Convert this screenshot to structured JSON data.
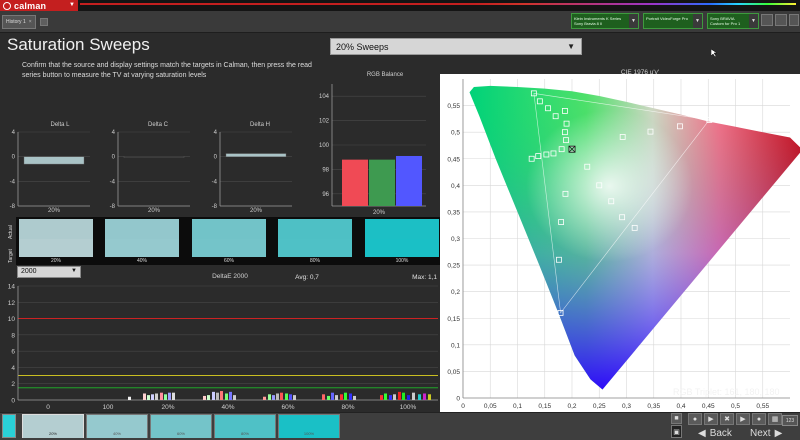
{
  "app": {
    "logo_text": "calman",
    "history_tab": "History 1",
    "devices": [
      {
        "line1": "Klein Instruments K Series",
        "line2": "Sony Bravia 8 II"
      },
      {
        "line1": "Portrait VideoForge Pro",
        "line2": ""
      },
      {
        "line1": "Sony BRAVIA",
        "line2": "Custom for Pro 1"
      }
    ]
  },
  "header": {
    "title": "Saturation Sweeps",
    "instructions": "Confirm that the source and display settings match the targets in Calman, then press the read series button to measure the TV at varying saturation levels",
    "sweep_select": "20% Sweeps"
  },
  "delta_charts": [
    {
      "title": "Delta L",
      "x_label": "20%",
      "value": -1.2,
      "bar_color": "#a9c3c6"
    },
    {
      "title": "Delta C",
      "x_label": "20%",
      "value": 0.05,
      "bar_color": "#1b1b1b"
    },
    {
      "title": "Delta H",
      "x_label": "20%",
      "value": 0.5,
      "bar_color": "#a9c3c6"
    }
  ],
  "delta_ticks": [
    "4",
    "0",
    "-4",
    "-8"
  ],
  "rgb_balance": {
    "title": "RGB Balance",
    "x_label": "20%",
    "ticks": [
      "104",
      "102",
      "100",
      "98",
      "96"
    ],
    "values": {
      "r": 98.8,
      "g": 98.8,
      "b": 99.1
    },
    "colors": {
      "r": "#f04a55",
      "g": "#3e9a50",
      "b": "#5257ff"
    }
  },
  "swatches": {
    "side_labels": [
      "Target",
      "Actual"
    ],
    "items": [
      {
        "label": "20%",
        "target": "#b4ced1",
        "actual": "#aecbce"
      },
      {
        "label": "40%",
        "target": "#95c9ce",
        "actual": "#93c7cc"
      },
      {
        "label": "60%",
        "target": "#74c4c9",
        "actual": "#72c3c8"
      },
      {
        "label": "80%",
        "target": "#4fc1c6",
        "actual": "#4ec0c5"
      },
      {
        "label": "100%",
        "target": "#1ac0c6",
        "actual": "#1cbfc5"
      }
    ]
  },
  "deltae": {
    "select_value": "2000",
    "title": "DeltaE 2000",
    "avg": "Avg: 0,7",
    "max": "Max: 1,1",
    "y_ticks": [
      "14",
      "12",
      "10",
      "8",
      "6",
      "4",
      "2",
      "0"
    ],
    "x_ticks": [
      "0",
      "100",
      "20%",
      "40%",
      "60%",
      "80%",
      "100%"
    ]
  },
  "cie": {
    "title": "CIE 1976 u'v'",
    "y_ticks": [
      "0,55",
      "0,5",
      "0,45",
      "0,4",
      "0,35",
      "0,3",
      "0,25",
      "0,2",
      "0,15",
      "0,1",
      "0,05",
      "0"
    ],
    "x_ticks": [
      "0",
      "0,05",
      "0,1",
      "0,15",
      "0,2",
      "0,25",
      "0,3",
      "0,35",
      "0,4",
      "0,45",
      "0,5",
      "0,55"
    ],
    "triplet": "RGB Triplet: 161, 180, 180"
  },
  "chart_data": [
    {
      "type": "bar",
      "title": "Delta L",
      "categories": [
        "20%"
      ],
      "values": [
        -1.2
      ],
      "ylim": [
        -8,
        4
      ]
    },
    {
      "type": "bar",
      "title": "Delta C",
      "categories": [
        "20%"
      ],
      "values": [
        0.05
      ],
      "ylim": [
        -8,
        4
      ]
    },
    {
      "type": "bar",
      "title": "Delta H",
      "categories": [
        "20%"
      ],
      "values": [
        0.5
      ],
      "ylim": [
        -8,
        4
      ]
    },
    {
      "type": "bar",
      "title": "RGB Balance",
      "categories": [
        "20%"
      ],
      "series": [
        {
          "name": "R",
          "values": [
            98.8
          ]
        },
        {
          "name": "G",
          "values": [
            98.8
          ]
        },
        {
          "name": "B",
          "values": [
            99.1
          ]
        }
      ],
      "ylim": [
        95,
        105
      ]
    },
    {
      "type": "bar",
      "title": "DeltaE 2000",
      "ylim": [
        0,
        14
      ]
    },
    {
      "type": "scatter",
      "title": "CIE 1976 u'v'",
      "xlim": [
        0,
        0.6
      ],
      "ylim": [
        0,
        0.6
      ],
      "targets": [
        [
          0.452,
          0.523
        ],
        [
          0.398,
          0.511
        ],
        [
          0.344,
          0.501
        ],
        [
          0.293,
          0.491
        ],
        [
          0.2,
          0.468
        ],
        [
          0.228,
          0.435
        ],
        [
          0.25,
          0.4
        ],
        [
          0.272,
          0.37
        ],
        [
          0.292,
          0.34
        ],
        [
          0.315,
          0.32
        ],
        [
          0.188,
          0.384
        ],
        [
          0.18,
          0.331
        ],
        [
          0.176,
          0.26
        ],
        [
          0.179,
          0.16
        ],
        [
          0.181,
          0.468
        ],
        [
          0.166,
          0.46
        ],
        [
          0.153,
          0.458
        ],
        [
          0.138,
          0.455
        ],
        [
          0.126,
          0.45
        ],
        [
          0.13,
          0.573
        ],
        [
          0.141,
          0.558
        ],
        [
          0.156,
          0.545
        ],
        [
          0.17,
          0.53
        ],
        [
          0.187,
          0.54
        ],
        [
          0.19,
          0.516
        ],
        [
          0.187,
          0.5
        ],
        [
          0.189,
          0.485
        ]
      ]
    }
  ],
  "bottom": {
    "thumb_labels": [
      "20%",
      "40%",
      "60%",
      "80%",
      "100%"
    ],
    "thumb_colors": [
      "#b4ced1",
      "#95c9ce",
      "#74c4c9",
      "#4fc1c6",
      "#1ac0c6"
    ],
    "back_label": "Back",
    "next_label": "Next",
    "page_num": "123"
  }
}
